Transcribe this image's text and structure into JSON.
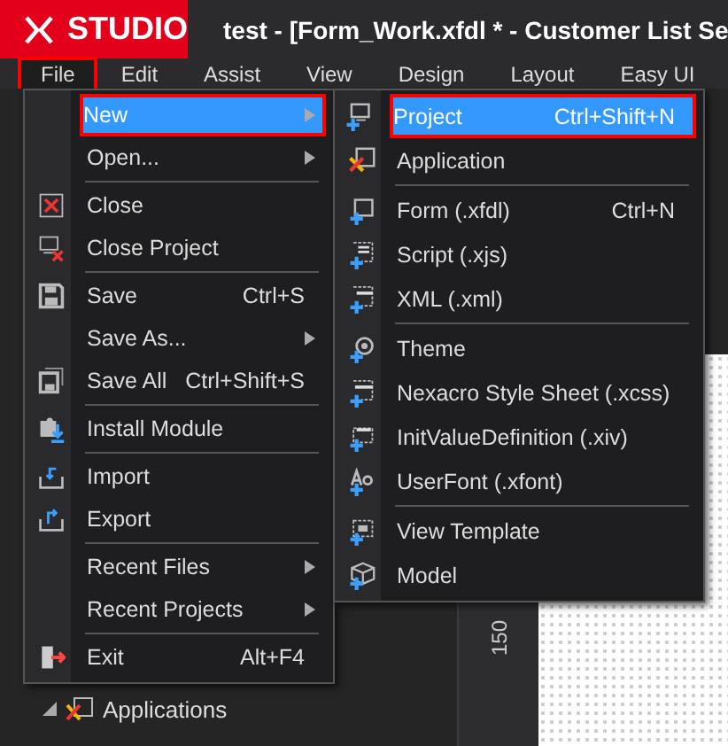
{
  "title_bar": {
    "logo": "STUDIO",
    "title": "test - [Form_Work.xfdl * - Customer List Se"
  },
  "menu_bar": [
    {
      "label": "File",
      "selected": true
    },
    {
      "label": "Edit",
      "selected": false
    },
    {
      "label": "Assist",
      "selected": false
    },
    {
      "label": "View",
      "selected": false
    },
    {
      "label": "Design",
      "selected": false
    },
    {
      "label": "Layout",
      "selected": false
    },
    {
      "label": "Easy UI",
      "selected": false
    }
  ],
  "explorer": {
    "tree": [
      {
        "label": "Applications",
        "expanded": true
      }
    ]
  },
  "design_panel": {
    "ruler_label": "150"
  },
  "file_menu": [
    {
      "kind": "item",
      "label": "New",
      "submenu": true,
      "selected": true
    },
    {
      "kind": "item",
      "label": "Open...",
      "submenu": true,
      "selected": false
    },
    {
      "kind": "separator"
    },
    {
      "kind": "item",
      "label": "Close",
      "selected": false
    },
    {
      "kind": "item",
      "label": "Close Project",
      "selected": false
    },
    {
      "kind": "separator"
    },
    {
      "kind": "item",
      "label": "Save",
      "shortcut": "Ctrl+S",
      "selected": false
    },
    {
      "kind": "item",
      "label": "Save As...",
      "submenu": true,
      "selected": false
    },
    {
      "kind": "item",
      "label": "Save All",
      "shortcut": "Ctrl+Shift+S",
      "selected": false
    },
    {
      "kind": "separator"
    },
    {
      "kind": "item",
      "label": "Install Module",
      "selected": false
    },
    {
      "kind": "separator"
    },
    {
      "kind": "item",
      "label": "Import",
      "selected": false
    },
    {
      "kind": "item",
      "label": "Export",
      "selected": false
    },
    {
      "kind": "separator"
    },
    {
      "kind": "item",
      "label": "Recent Files",
      "submenu": true,
      "selected": false
    },
    {
      "kind": "item",
      "label": "Recent Projects",
      "submenu": true,
      "selected": false
    },
    {
      "kind": "separator"
    },
    {
      "kind": "item",
      "label": "Exit",
      "shortcut": "Alt+F4",
      "selected": false
    }
  ],
  "new_submenu": [
    {
      "kind": "item",
      "label": "Project",
      "shortcut": "Ctrl+Shift+N",
      "selected": true
    },
    {
      "kind": "item",
      "label": "Application",
      "selected": false
    },
    {
      "kind": "separator"
    },
    {
      "kind": "item",
      "label": "Form (.xfdl)",
      "shortcut": "Ctrl+N",
      "selected": false
    },
    {
      "kind": "item",
      "label": "Script (.xjs)",
      "selected": false
    },
    {
      "kind": "item",
      "label": "XML (.xml)",
      "selected": false
    },
    {
      "kind": "separator"
    },
    {
      "kind": "item",
      "label": "Theme",
      "selected": false
    },
    {
      "kind": "item",
      "label": "Nexacro Style Sheet (.xcss)",
      "selected": false
    },
    {
      "kind": "item",
      "label": "InitValueDefinition (.xiv)",
      "selected": false
    },
    {
      "kind": "item",
      "label": "UserFont (.xfont)",
      "selected": false
    },
    {
      "kind": "separator"
    },
    {
      "kind": "item",
      "label": "View Template",
      "selected": false
    },
    {
      "kind": "item",
      "label": "Model",
      "selected": false
    }
  ]
}
